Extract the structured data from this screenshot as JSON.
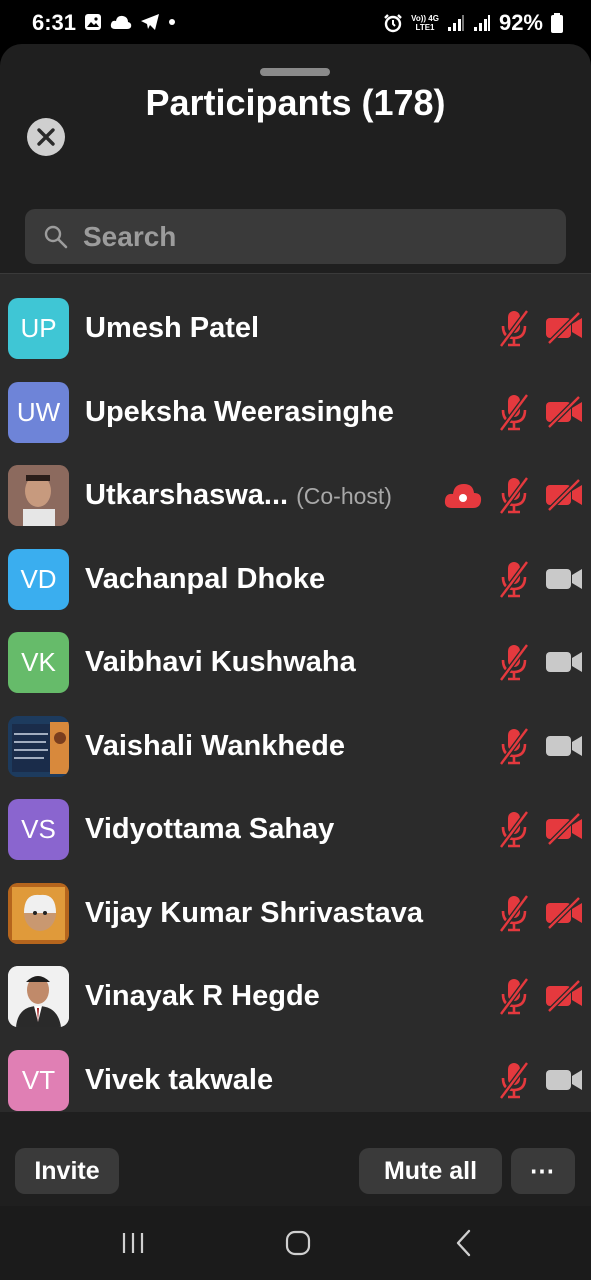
{
  "status_bar": {
    "time": "6:31",
    "network_top": "Vo)) 4G",
    "network_bottom": "LTE1",
    "battery": "92%"
  },
  "header": {
    "title": "Participants (178)"
  },
  "search": {
    "placeholder": "Search"
  },
  "colors": {
    "muted_red": "#e5393e",
    "camera_on_gray": "#c9c9c9"
  },
  "participants": [
    {
      "name": "Umesh Patel",
      "initials": "UP",
      "avatar_color": "#3fc6d5",
      "photo": false,
      "role": "",
      "mic": "muted",
      "video": "off"
    },
    {
      "name": "Upeksha Weerasinghe",
      "initials": "UW",
      "avatar_color": "#6e84d8",
      "photo": false,
      "role": "",
      "mic": "muted",
      "video": "off"
    },
    {
      "name": "Utkarshaswa...",
      "initials": "",
      "avatar_color": "#7a5a52",
      "photo": true,
      "role": "(Co-host)",
      "recording": true,
      "mic": "muted",
      "video": "off"
    },
    {
      "name": "Vachanpal Dhoke",
      "initials": "VD",
      "avatar_color": "#3aaeef",
      "photo": false,
      "role": "",
      "mic": "muted",
      "video": "on"
    },
    {
      "name": "Vaibhavi Kushwaha",
      "initials": "VK",
      "avatar_color": "#66bb6a",
      "photo": false,
      "role": "",
      "mic": "muted",
      "video": "on"
    },
    {
      "name": "Vaishali Wankhede",
      "initials": "",
      "avatar_color": "#1d3b5e",
      "photo": true,
      "role": "",
      "mic": "muted",
      "video": "on"
    },
    {
      "name": "Vidyottama Sahay",
      "initials": "VS",
      "avatar_color": "#8a65cf",
      "photo": false,
      "role": "",
      "mic": "muted",
      "video": "off"
    },
    {
      "name": "Vijay Kumar Shrivastava",
      "initials": "",
      "avatar_color": "#b5651d",
      "photo": true,
      "role": "",
      "mic": "muted",
      "video": "off"
    },
    {
      "name": "Vinayak R Hegde",
      "initials": "",
      "avatar_color": "#eeeeee",
      "photo": true,
      "role": "",
      "mic": "muted",
      "video": "off"
    },
    {
      "name": "Vivek takwale",
      "initials": "VT",
      "avatar_color": "#e07fb4",
      "photo": false,
      "role": "",
      "mic": "muted",
      "video": "on"
    }
  ],
  "footer": {
    "invite_label": "Invite",
    "mute_all_label": "Mute all",
    "more_label": "⋯"
  }
}
